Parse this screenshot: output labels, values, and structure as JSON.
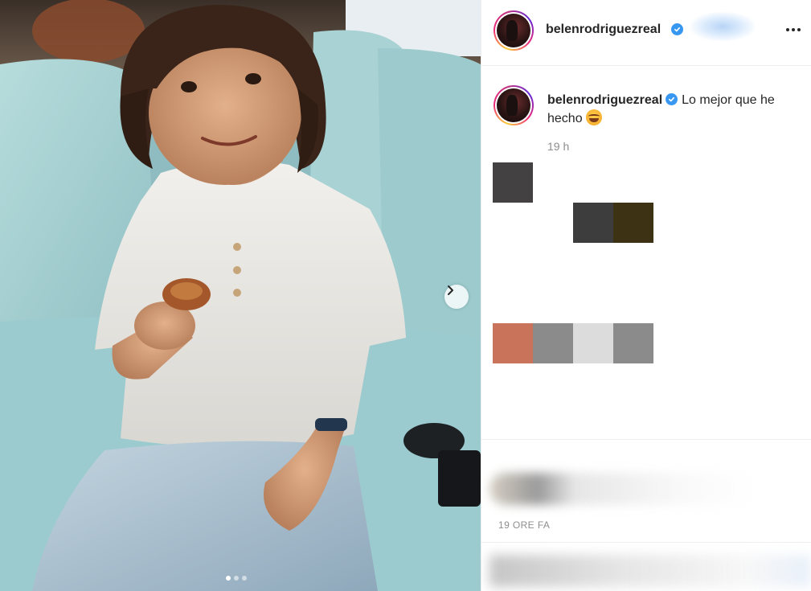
{
  "post": {
    "username": "belenrodriguezreal",
    "caption_text": "Lo mejor que he hecho",
    "emoji": "smiling-face-with-hearts-emoji",
    "relative_time": "19 h",
    "date_label": "19 ORE FA"
  },
  "carousel": {
    "current_slide": 1,
    "total_slides": 3,
    "next_icon": "chevron-right-icon"
  },
  "colors": {
    "verified_badge": "#3897f0",
    "divider": "#efefef",
    "muted_text": "#8e8e8e",
    "swatch_row_1": [
      "#434141"
    ],
    "swatch_row_2": [
      "#3d3d3d",
      "#3e3214"
    ],
    "swatch_row_3": [
      "#c8735a",
      "#8b8b8b",
      "#dcdcdc",
      "#8b8b8b"
    ]
  }
}
